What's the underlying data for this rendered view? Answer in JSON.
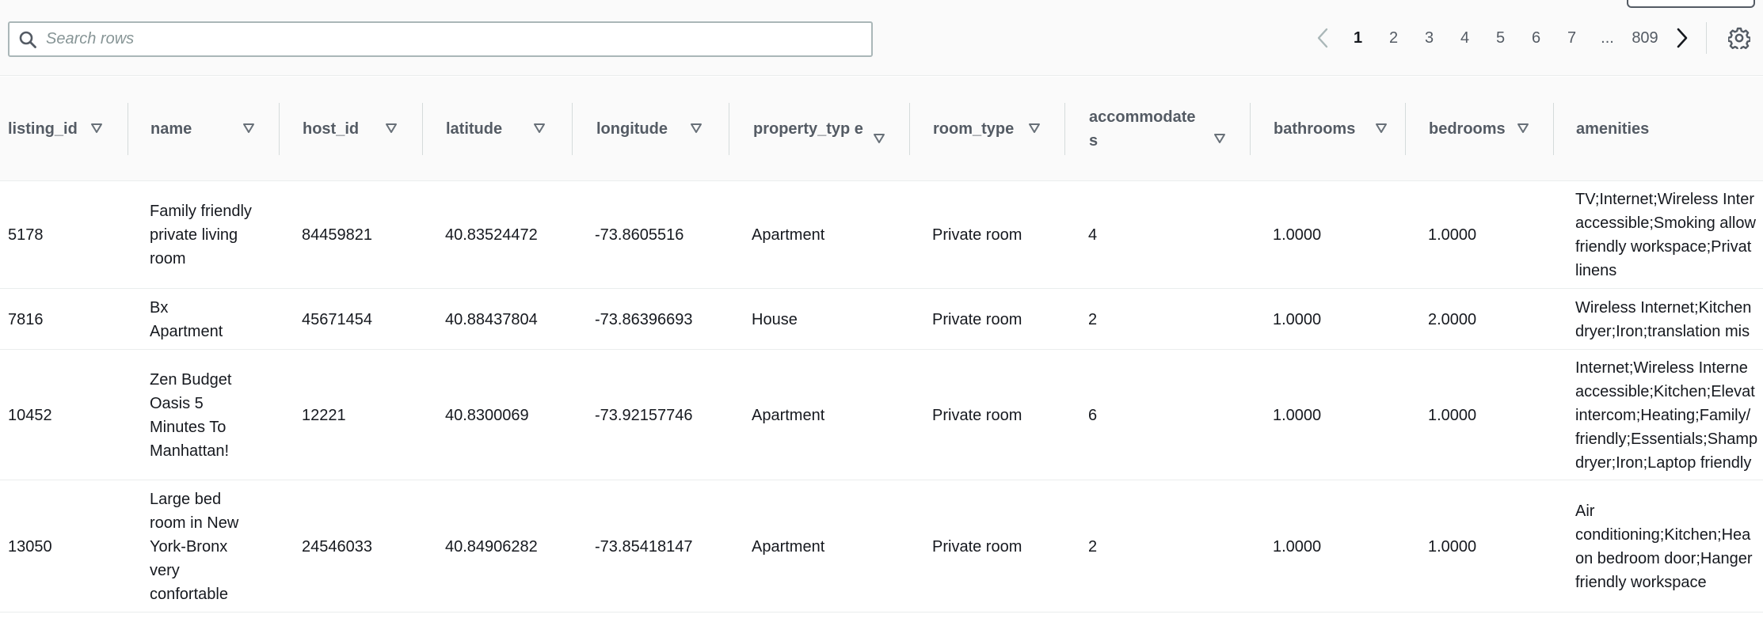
{
  "search": {
    "placeholder": "Search rows",
    "value": ""
  },
  "pagination": {
    "pages": [
      "1",
      "2",
      "3",
      "4",
      "5",
      "6",
      "7"
    ],
    "ellipsis": "...",
    "last_page": "809",
    "current": "1"
  },
  "columns": [
    {
      "key": "listing_id",
      "label": "listing_id"
    },
    {
      "key": "name",
      "label": "name"
    },
    {
      "key": "host_id",
      "label": "host_id"
    },
    {
      "key": "latitude",
      "label": "latitude"
    },
    {
      "key": "longitude",
      "label": "longitude"
    },
    {
      "key": "property_type",
      "label": "property_typ e"
    },
    {
      "key": "room_type",
      "label": "room_type"
    },
    {
      "key": "accommodates",
      "label": "accommodate s"
    },
    {
      "key": "bathrooms",
      "label": "bathrooms"
    },
    {
      "key": "bedrooms",
      "label": "bedrooms"
    },
    {
      "key": "amenities",
      "label": "amenities"
    }
  ],
  "rows": [
    {
      "listing_id": "5178",
      "name": "Family friendly private living room",
      "host_id": "84459821",
      "latitude": "40.83524472",
      "longitude": "-73.8605516",
      "property_type": "Apartment",
      "room_type": "Private room",
      "accommodates": "4",
      "bathrooms": "1.0000",
      "bedrooms": "1.0000",
      "amenities": [
        "TV;Internet;Wireless Inter",
        "accessible;Smoking allow",
        "friendly workspace;Privat",
        "linens"
      ]
    },
    {
      "listing_id": "7816",
      "name": "Bx Apartment",
      "host_id": "45671454",
      "latitude": "40.88437804",
      "longitude": "-73.86396693",
      "property_type": "House",
      "room_type": "Private room",
      "accommodates": "2",
      "bathrooms": "1.0000",
      "bedrooms": "2.0000",
      "amenities": [
        "Wireless Internet;Kitchen",
        "dryer;Iron;translation mis"
      ]
    },
    {
      "listing_id": "10452",
      "name": "Zen Budget Oasis 5 Minutes To Manhattan!",
      "host_id": "12221",
      "latitude": "40.8300069",
      "longitude": "-73.92157746",
      "property_type": "Apartment",
      "room_type": "Private room",
      "accommodates": "6",
      "bathrooms": "1.0000",
      "bedrooms": "1.0000",
      "amenities": [
        "Internet;Wireless Interne",
        "accessible;Kitchen;Elevat",
        "intercom;Heating;Family/",
        "friendly;Essentials;Shamp",
        "dryer;Iron;Laptop friendly"
      ]
    },
    {
      "listing_id": "13050",
      "name": "Large bed room in New York-Bronx very confortable",
      "host_id": "24546033",
      "latitude": "40.84906282",
      "longitude": "-73.85418147",
      "property_type": "Apartment",
      "room_type": "Private room",
      "accommodates": "2",
      "bathrooms": "1.0000",
      "bedrooms": "1.0000",
      "amenities": [
        "Air",
        "conditioning;Kitchen;Hea",
        "on bedroom door;Hanger",
        "friendly workspace"
      ]
    }
  ]
}
